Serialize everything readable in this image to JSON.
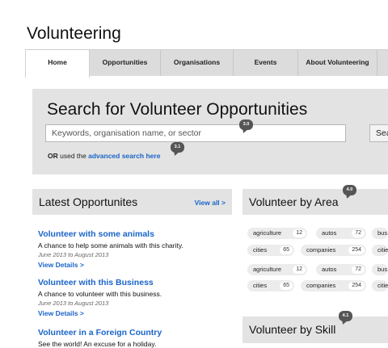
{
  "site": {
    "title": "Volunteering"
  },
  "nav": {
    "tabs": [
      {
        "label": "Home",
        "active": true
      },
      {
        "label": "Opportunities",
        "active": false
      },
      {
        "label": "Organisations",
        "active": false
      },
      {
        "label": "Events",
        "active": false
      },
      {
        "label": "About Volunteering",
        "active": false
      }
    ]
  },
  "search": {
    "title": "Search for Volunteer Opportunities",
    "placeholder": "Keywords, organisation name, or sector",
    "button_label": "Search",
    "or_text": "OR",
    "used_text": "used the",
    "advanced_link": "advanced search here"
  },
  "markers": {
    "search_input": "3.0",
    "advanced": "3.1",
    "area": "4.0",
    "skill": "4.1"
  },
  "latest": {
    "title": "Latest Opportunites",
    "view_all": "View all >",
    "items": [
      {
        "title": "Volunteer with some animals",
        "desc": "A chance to help some animals with this charity.",
        "dates": "June 2013 to August 2013",
        "link": "View Details >"
      },
      {
        "title": "Volunteer with this Business",
        "desc": "A chance to volunteer with this business.",
        "dates": "June 2013 to August 2013",
        "link": "View Details >"
      },
      {
        "title": "Volunteer in a Foreign Country",
        "desc": "See the world! An excuse for a holiday.",
        "dates": "",
        "link": ""
      }
    ]
  },
  "area": {
    "title": "Volunteer by Area",
    "rows": [
      [
        {
          "label": "agriculture",
          "count": "12"
        },
        {
          "label": "autos",
          "count": "72"
        },
        {
          "label": "bus",
          "count": ""
        }
      ],
      [
        {
          "label": "cities",
          "count": "65"
        },
        {
          "label": "companies",
          "count": "254"
        },
        {
          "label": "citie",
          "count": ""
        }
      ],
      [
        {
          "label": "agriculture",
          "count": "12"
        },
        {
          "label": "autos",
          "count": "72"
        },
        {
          "label": "bus",
          "count": ""
        }
      ],
      [
        {
          "label": "cities",
          "count": "65"
        },
        {
          "label": "companies",
          "count": "254"
        },
        {
          "label": "citie",
          "count": ""
        }
      ]
    ]
  },
  "skill": {
    "title": "Volunteer by Skill"
  },
  "colors": {
    "link": "#1a64c8",
    "panel": "#e3e3e3",
    "nav": "#dcdcdc",
    "marker": "#555555"
  }
}
